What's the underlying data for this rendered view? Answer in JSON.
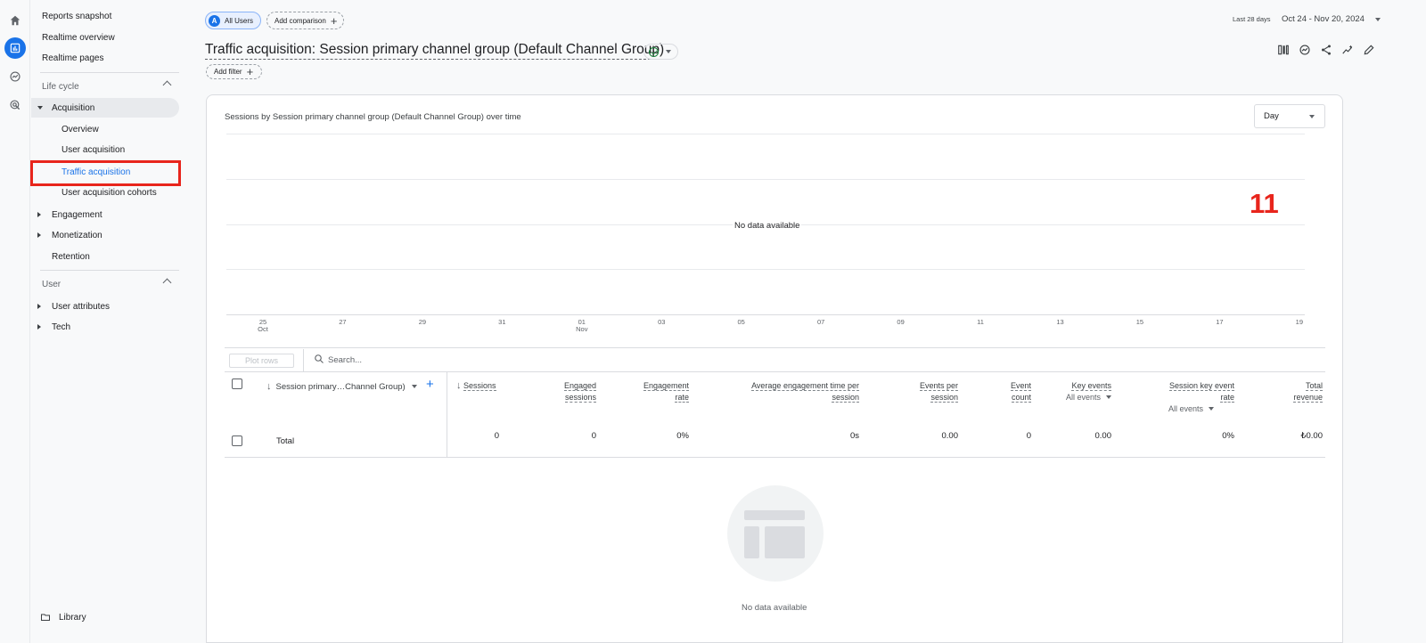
{
  "sidebar": {
    "items_top": [
      "Reports snapshot",
      "Realtime overview",
      "Realtime pages"
    ],
    "lifecycle_label": "Life cycle",
    "acquisition": "Acquisition",
    "acq_children": [
      "Overview",
      "User acquisition",
      "Traffic acquisition",
      "User acquisition cohorts"
    ],
    "engagement": "Engagement",
    "monetization": "Monetization",
    "retention": "Retention",
    "user_label": "User",
    "user_attributes": "User attributes",
    "tech": "Tech",
    "library": "Library"
  },
  "topbar": {
    "segment_avatar": "A",
    "segment": "All Users",
    "add_comparison": "Add comparison",
    "date_label": "Last 28 days",
    "date_range": "Oct 24 - Nov 20, 2024"
  },
  "page": {
    "title": "Traffic acquisition: Session primary channel group (Default Channel Group)",
    "add_filter": "Add filter"
  },
  "chart": {
    "title": "Sessions by Session primary channel group (Default Channel Group) over time",
    "granularity": "Day",
    "no_data": "No data available",
    "annotation": "11"
  },
  "chart_data": {
    "type": "line",
    "title": "Sessions by Session primary channel group (Default Channel Group) over time",
    "x_ticks": [
      {
        "day": "25",
        "month": "Oct"
      },
      {
        "day": "27",
        "month": ""
      },
      {
        "day": "29",
        "month": ""
      },
      {
        "day": "31",
        "month": ""
      },
      {
        "day": "01",
        "month": "Nov"
      },
      {
        "day": "03",
        "month": ""
      },
      {
        "day": "05",
        "month": ""
      },
      {
        "day": "07",
        "month": ""
      },
      {
        "day": "09",
        "month": ""
      },
      {
        "day": "11",
        "month": ""
      },
      {
        "day": "13",
        "month": ""
      },
      {
        "day": "15",
        "month": ""
      },
      {
        "day": "17",
        "month": ""
      },
      {
        "day": "19",
        "month": ""
      }
    ],
    "series": [],
    "grid": true
  },
  "table": {
    "plot_rows": "Plot rows",
    "search_placeholder": "Search...",
    "dimension_header": "Session primary…Channel Group)",
    "columns": [
      {
        "line1": "Sessions",
        "line2": ""
      },
      {
        "line1": "Engaged",
        "line2": "sessions"
      },
      {
        "line1": "Engagement",
        "line2": "rate"
      },
      {
        "line1": "Average engagement time per",
        "line2": "session"
      },
      {
        "line1": "Events per",
        "line2": "session"
      },
      {
        "line1": "Event",
        "line2": "count"
      },
      {
        "line1": "Key events",
        "line2": ""
      },
      {
        "line1": "Session key event",
        "line2": "rate"
      },
      {
        "line1": "Total",
        "line2": "revenue"
      }
    ],
    "key_events_filter": "All events",
    "key_event_rate_filter": "All events",
    "total_label": "Total",
    "totals": [
      "0",
      "0",
      "0%",
      "0s",
      "0.00",
      "0",
      "0.00",
      "0%",
      "₺0.00"
    ],
    "no_data": "No data available"
  }
}
